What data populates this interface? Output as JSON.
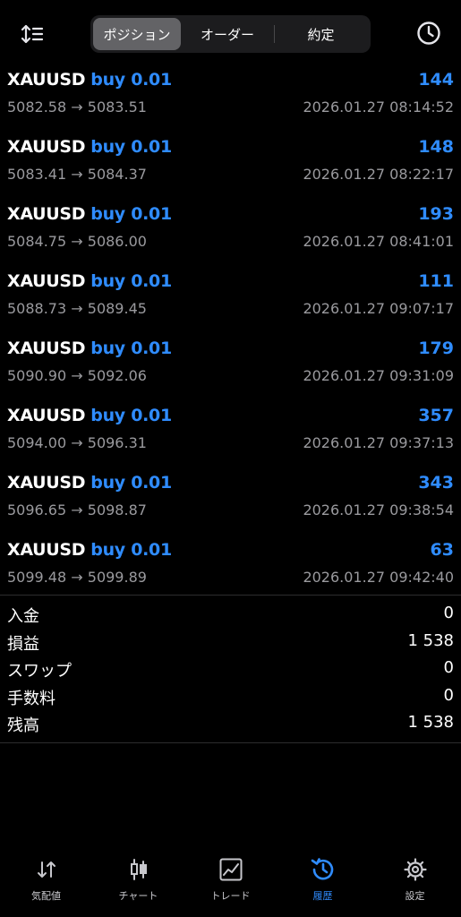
{
  "header": {
    "tabs": [
      {
        "label": "ポジション",
        "active": true
      },
      {
        "label": "オーダー",
        "active": false
      },
      {
        "label": "約定",
        "active": false
      }
    ]
  },
  "deals": [
    {
      "symbol": "XAUUSD",
      "side": "buy 0.01",
      "open": "5082.58",
      "close": "5083.51",
      "profit": "144",
      "time": "2026.01.27 08:14:52"
    },
    {
      "symbol": "XAUUSD",
      "side": "buy 0.01",
      "open": "5083.41",
      "close": "5084.37",
      "profit": "148",
      "time": "2026.01.27 08:22:17"
    },
    {
      "symbol": "XAUUSD",
      "side": "buy 0.01",
      "open": "5084.75",
      "close": "5086.00",
      "profit": "193",
      "time": "2026.01.27 08:41:01"
    },
    {
      "symbol": "XAUUSD",
      "side": "buy 0.01",
      "open": "5088.73",
      "close": "5089.45",
      "profit": "111",
      "time": "2026.01.27 09:07:17"
    },
    {
      "symbol": "XAUUSD",
      "side": "buy 0.01",
      "open": "5090.90",
      "close": "5092.06",
      "profit": "179",
      "time": "2026.01.27 09:31:09"
    },
    {
      "symbol": "XAUUSD",
      "side": "buy 0.01",
      "open": "5094.00",
      "close": "5096.31",
      "profit": "357",
      "time": "2026.01.27 09:37:13"
    },
    {
      "symbol": "XAUUSD",
      "side": "buy 0.01",
      "open": "5096.65",
      "close": "5098.87",
      "profit": "343",
      "time": "2026.01.27 09:38:54"
    },
    {
      "symbol": "XAUUSD",
      "side": "buy 0.01",
      "open": "5099.48",
      "close": "5099.89",
      "profit": "63",
      "time": "2026.01.27 09:42:40"
    }
  ],
  "arrow": "→",
  "summary": [
    {
      "label": "入金",
      "value": "0"
    },
    {
      "label": "損益",
      "value": "1 538"
    },
    {
      "label": "スワップ",
      "value": "0"
    },
    {
      "label": "手数料",
      "value": "0"
    },
    {
      "label": "残高",
      "value": "1 538"
    }
  ],
  "tabbar": [
    {
      "label": "気配値",
      "icon": "arrows-updown-icon",
      "active": false
    },
    {
      "label": "チャート",
      "icon": "candlestick-icon",
      "active": false
    },
    {
      "label": "トレード",
      "icon": "trade-chart-icon",
      "active": false
    },
    {
      "label": "履歴",
      "icon": "history-icon",
      "active": true
    },
    {
      "label": "設定",
      "icon": "gear-icon",
      "active": false
    }
  ],
  "colors": {
    "accent": "#2f8cff",
    "background": "#000000",
    "muted": "#9a9a9e"
  }
}
